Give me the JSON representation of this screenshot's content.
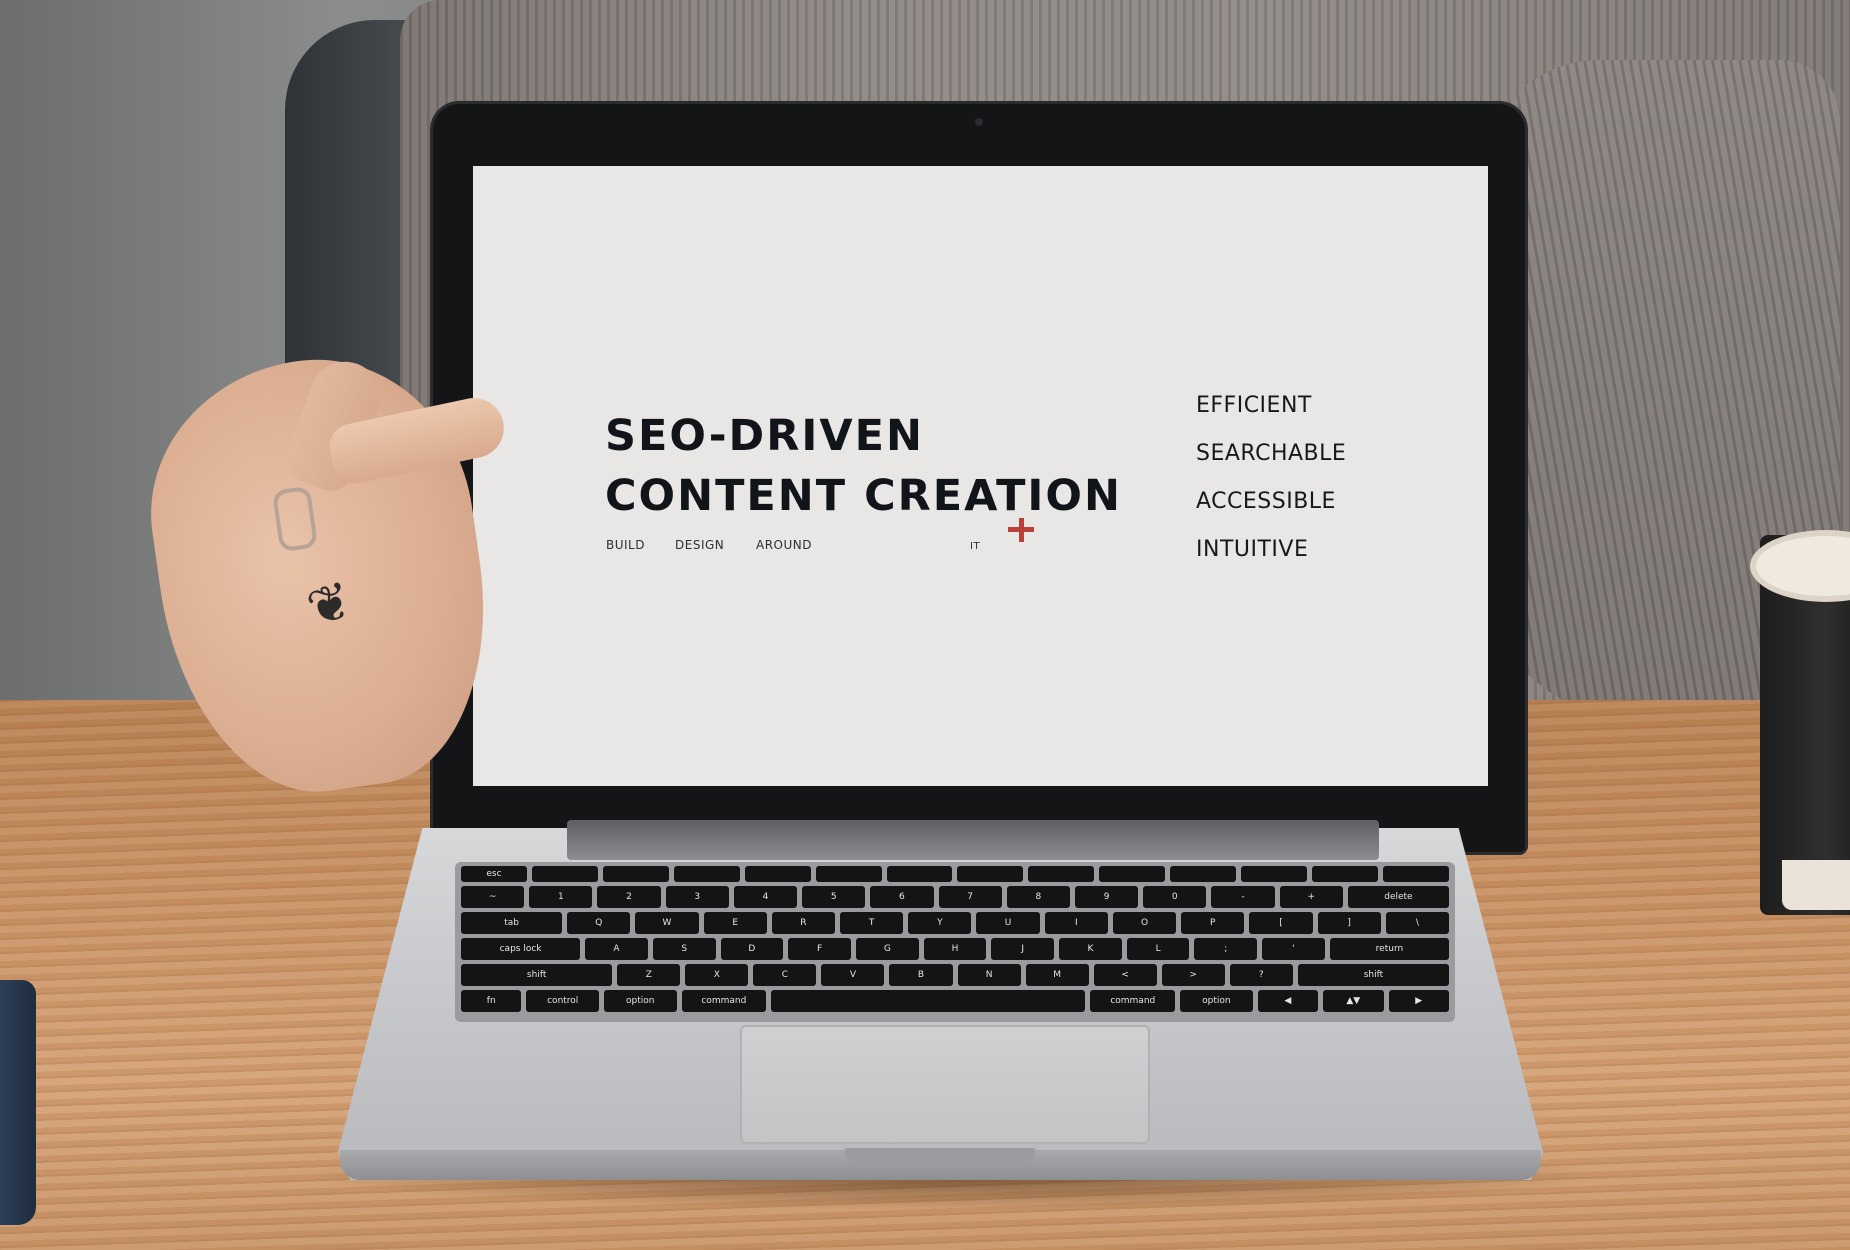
{
  "scene": {
    "description_free": true
  },
  "screen": {
    "headline_line1": "SEO-DRIVEN",
    "headline_line2": "CONTENT CREATION",
    "sub_build": "BUILD",
    "sub_design": "DESIGN",
    "sub_around": "AROUND",
    "sub_it": "IT",
    "accent_color": "#b8413c",
    "attributes": [
      "EFFICIENT",
      "SEARCHABLE",
      "ACCESSIBLE",
      "INTUITIVE"
    ]
  },
  "keyboard": {
    "fn_row": [
      "esc",
      "",
      "",
      "",
      "",
      "",
      "",
      "",
      "",
      "",
      "",
      "",
      "",
      ""
    ],
    "row1": [
      "~",
      "1",
      "2",
      "3",
      "4",
      "5",
      "6",
      "7",
      "8",
      "9",
      "0",
      "-",
      "+",
      "delete"
    ],
    "row2": [
      "tab",
      "Q",
      "W",
      "E",
      "R",
      "T",
      "Y",
      "U",
      "I",
      "O",
      "P",
      "[",
      "]",
      "\\"
    ],
    "row3": [
      "caps lock",
      "A",
      "S",
      "D",
      "F",
      "G",
      "H",
      "J",
      "K",
      "L",
      ";",
      "'",
      "return"
    ],
    "row4": [
      "shift",
      "Z",
      "X",
      "C",
      "V",
      "B",
      "N",
      "M",
      "<",
      ">",
      "?",
      "shift"
    ],
    "row5": [
      "fn",
      "control",
      "option",
      "command",
      "",
      "command",
      "option",
      "◀",
      "▲▼",
      "▶"
    ]
  }
}
